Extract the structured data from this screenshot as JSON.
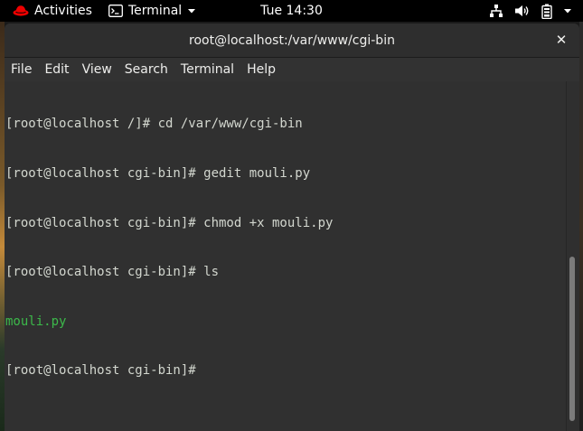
{
  "topbar": {
    "activities_label": "Activities",
    "app_menu_label": "Terminal",
    "clock": "Tue 14:30",
    "icons": [
      "redhat-logo-icon",
      "terminal-app-icon",
      "network-icon",
      "volume-icon",
      "battery-icon",
      "chevron-down-icon"
    ]
  },
  "window": {
    "title": "root@localhost:/var/www/cgi-bin",
    "close_symbol": "✕"
  },
  "menubar": {
    "items": [
      "File",
      "Edit",
      "View",
      "Search",
      "Terminal",
      "Help"
    ]
  },
  "terminal": {
    "lines": [
      "[root@localhost /]# cd /var/www/cgi-bin",
      "[root@localhost cgi-bin]# gedit mouli.py",
      "[root@localhost cgi-bin]# chmod +x mouli.py",
      "[root@localhost cgi-bin]# ls",
      "mouli.py",
      "[root@localhost cgi-bin]#"
    ],
    "colors": {
      "text": "#d3d7cf",
      "executable_file": "#3cb94a",
      "background": "#303030"
    }
  }
}
